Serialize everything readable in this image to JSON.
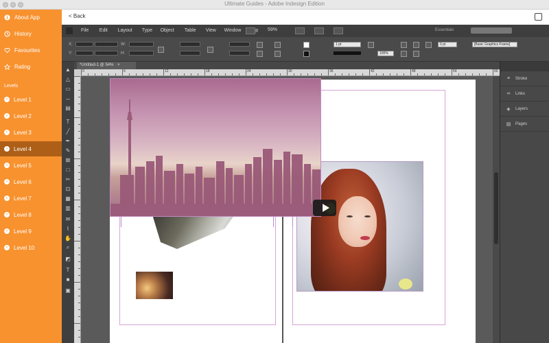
{
  "window": {
    "title": "Ultimate Guides - Adobe Indesign Edition"
  },
  "header": {
    "back_label": "< Back"
  },
  "sidebar": {
    "top_items": [
      {
        "label": "About App",
        "icon": "info-icon"
      },
      {
        "label": "History",
        "icon": "clock-icon"
      },
      {
        "label": "Favourites",
        "icon": "heart-icon"
      },
      {
        "label": "Rating",
        "icon": "star-icon"
      }
    ],
    "section_label": "Levels",
    "levels": [
      "Level 1",
      "Level 2",
      "Level 3",
      "Level 4",
      "Level 5",
      "Level 6",
      "Level 7",
      "Level 8",
      "Level 9",
      "Level 10"
    ],
    "active_level": "Level 4",
    "accent_color": "#f8922f",
    "active_color": "#ad5f17"
  },
  "indesign": {
    "menu": [
      "File",
      "Edit",
      "Layout",
      "Type",
      "Object",
      "Table",
      "View",
      "Window",
      "Help"
    ],
    "zoom": "59%",
    "workspace": "Essentials",
    "document_tab": "*Untitled-1 @ 54%",
    "control": {
      "stroke_weight": "1 pt",
      "opacity": "100%",
      "fill_field": "0 pt",
      "frame_style": "[Basic Graphics Frame]"
    },
    "ruler_numbers": [
      "0",
      "6",
      "12",
      "18",
      "24",
      "30",
      "36",
      "42",
      "48",
      "54",
      "60",
      "66"
    ],
    "panels": [
      {
        "label": "Stroke",
        "icon": "stroke-icon"
      },
      {
        "label": "Links",
        "icon": "links-icon"
      },
      {
        "label": "Layers",
        "icon": "layers-icon"
      },
      {
        "label": "Pages",
        "icon": "pages-icon"
      }
    ]
  }
}
